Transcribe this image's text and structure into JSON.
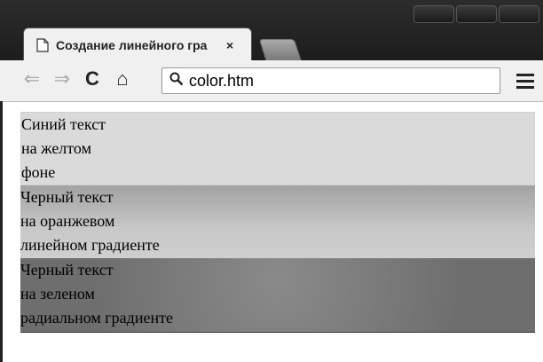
{
  "browser": {
    "tab_title": "Создание линейного гра",
    "tab_close": "×",
    "url": "color.htm",
    "icons": [
      "page-icon",
      "close-icon",
      "back-arrow-icon",
      "forward-arrow-icon",
      "reload-icon",
      "home-icon",
      "search-icon",
      "menu-icon"
    ],
    "back_glyph": "⇐",
    "forward_glyph": "⇒",
    "reload_glyph": "C",
    "home_glyph": "⌂"
  },
  "page": {
    "blocks": [
      {
        "lines": [
          "Синий текст",
          "на желтом",
          "фоне"
        ]
      },
      {
        "lines": [
          "Черный текст",
          "на оранжевом",
          "линейном градиенте"
        ]
      },
      {
        "lines": [
          "Черный текст",
          "на зеленом",
          "радиальном градиенте"
        ]
      }
    ]
  }
}
